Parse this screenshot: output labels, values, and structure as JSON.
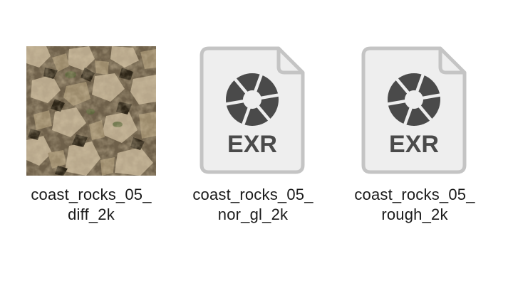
{
  "files": [
    {
      "label_line1": "coast_rocks_05_",
      "label_line2": "diff_2k",
      "icon": "image-thumbnail-icon"
    },
    {
      "label_line1": "coast_rocks_05_",
      "label_line2": "nor_gl_2k",
      "icon": "exr-file-icon",
      "badge": "EXR"
    },
    {
      "label_line1": "coast_rocks_05_",
      "label_line2": "rough_2k",
      "icon": "exr-file-icon",
      "badge": "EXR"
    }
  ],
  "colors": {
    "icon_fill": "#eeeeee",
    "icon_stroke": "#c4c4c4",
    "aperture": "#4a4a4a",
    "label": "#1a1a1a"
  }
}
